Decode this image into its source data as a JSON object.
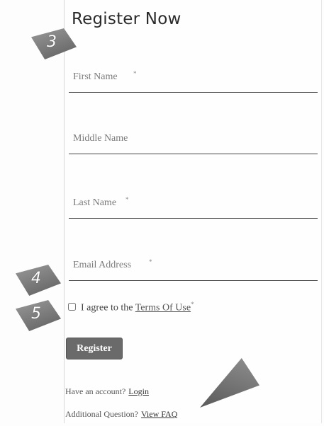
{
  "form": {
    "title": "Register Now",
    "fields": [
      {
        "placeholder": "First Name",
        "required_mark": "*"
      },
      {
        "placeholder": "Middle Name",
        "required_mark": ""
      },
      {
        "placeholder": "Last Name",
        "required_mark": "*"
      },
      {
        "placeholder": "Email Address",
        "required_mark": "*"
      }
    ],
    "agree_text": "I agree to the",
    "terms_link": "Terms Of Use",
    "terms_required_mark": "*",
    "register_label": "Register",
    "account_text": "Have an account?",
    "login_link": "Login",
    "question_text": "Additional Question?",
    "faq_link": "View FAQ"
  },
  "markers": [
    "3",
    "4",
    "5"
  ]
}
